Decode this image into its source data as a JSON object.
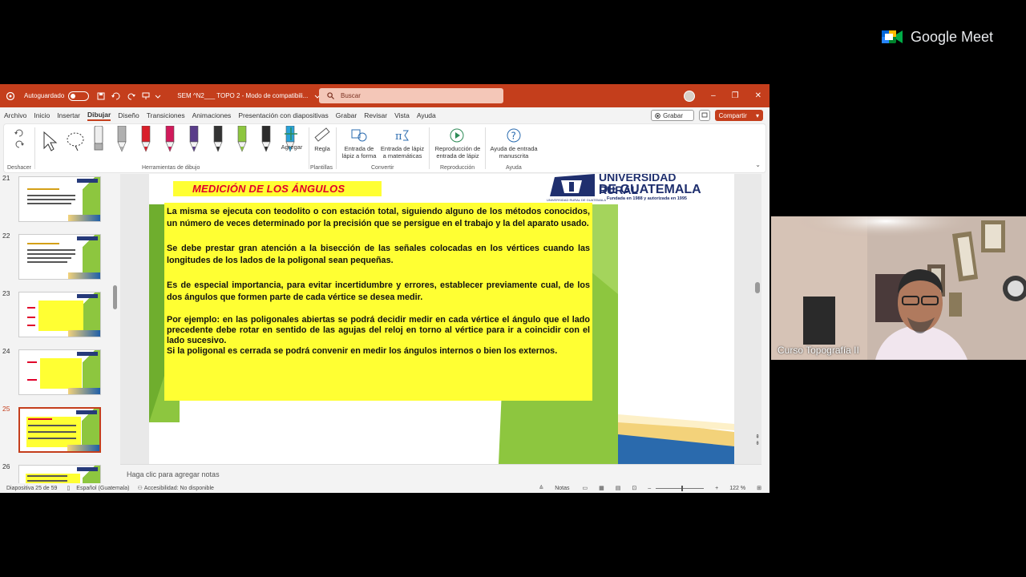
{
  "meet": {
    "brand": "Google Meet"
  },
  "titlebar": {
    "autosave": "Autoguardado",
    "filename": "SEM ^N2___ TOPO 2  -  Modo de compatibili...",
    "search_placeholder": "Buscar"
  },
  "menu": {
    "items": [
      "Archivo",
      "Inicio",
      "Insertar",
      "Dibujar",
      "Diseño",
      "Transiciones",
      "Animaciones",
      "Presentación con diapositivas",
      "Grabar",
      "Revisar",
      "Vista",
      "Ayuda"
    ],
    "active": "Dibujar",
    "record_label": "Grabar",
    "share_label": "Compartir"
  },
  "ribbon": {
    "undo_group": "Deshacer",
    "draw_tools_group": "Herramientas de dibujo",
    "add_label": "Agregar",
    "ruler_label": "Regla",
    "templates_group": "Plantillas",
    "ink_to_shape": "Entrada de lápiz a forma",
    "ink_to_math": "Entrada de lápiz a matemáticas",
    "convert_group": "Convertir",
    "ink_replay": "Reproducción de entrada de lápiz",
    "replay_group": "Reproducción",
    "ink_help": "Ayuda de entrada manuscrita",
    "help_group": "Ayuda",
    "pen_colors": [
      "#b0b0b0",
      "#d91f2a",
      "#d11a5b",
      "#5a3d8a",
      "#333333",
      "#8dc63f",
      "#2b2b2b",
      "#29a3d9"
    ]
  },
  "thumbnails": {
    "numbers": [
      "21",
      "22",
      "23",
      "24",
      "25",
      "26"
    ],
    "active": "25"
  },
  "slide": {
    "title": "MEDICIÓN DE LOS ÁNGULOS",
    "p1": "La misma se ejecuta con teodolito o con estación total, siguiendo alguno de los métodos conocidos, un número de veces determinado por la precisión que se persigue en el trabajo y la del aparato usado.",
    "p2": "Se debe prestar gran atención a la bisección de las señales colocadas en los vértices cuando las longitudes de los lados de la poligonal sean pequeñas.",
    "p3": "Es de especial importancia, para evitar incertidumbre y errores, establecer previamente cual, de los dos ángulos que formen parte de cada vértice se desea medir.",
    "p4": "Por ejemplo: en las poligonales abiertas se podrá decidir medir en cada vértice el ángulo que el lado precedente debe rotar en sentido de las agujas del reloj en torno al vértice para ir a coincidir con el lado sucesivo.",
    "p5": "Si la poligonal es cerrada se podrá convenir en medir los ángulos internos o bien los externos.",
    "uni_line1": "UNIVERSIDAD RURAL",
    "uni_line2": "DE GUATEMALA",
    "uni_tagline": "Fundada en 1988 y autorizada en 1995",
    "uni_small": "UNIVERSIDAD RURAL DE GUATEMALA"
  },
  "notes_placeholder": "Haga clic para agregar notas",
  "status": {
    "slide_count": "Diapositiva 25 de 59",
    "language": "Español (Guatemala)",
    "accessibility": "Accesibilidad: No disponible",
    "notes": "Notas",
    "zoom": "122 %"
  },
  "webcam": {
    "name": "Curso Topografía II"
  },
  "colors": {
    "ppt_accent": "#c43e1c",
    "slide_yellow": "#ffff33",
    "slide_green": "#8dc63f",
    "title_red": "#e0002a"
  }
}
